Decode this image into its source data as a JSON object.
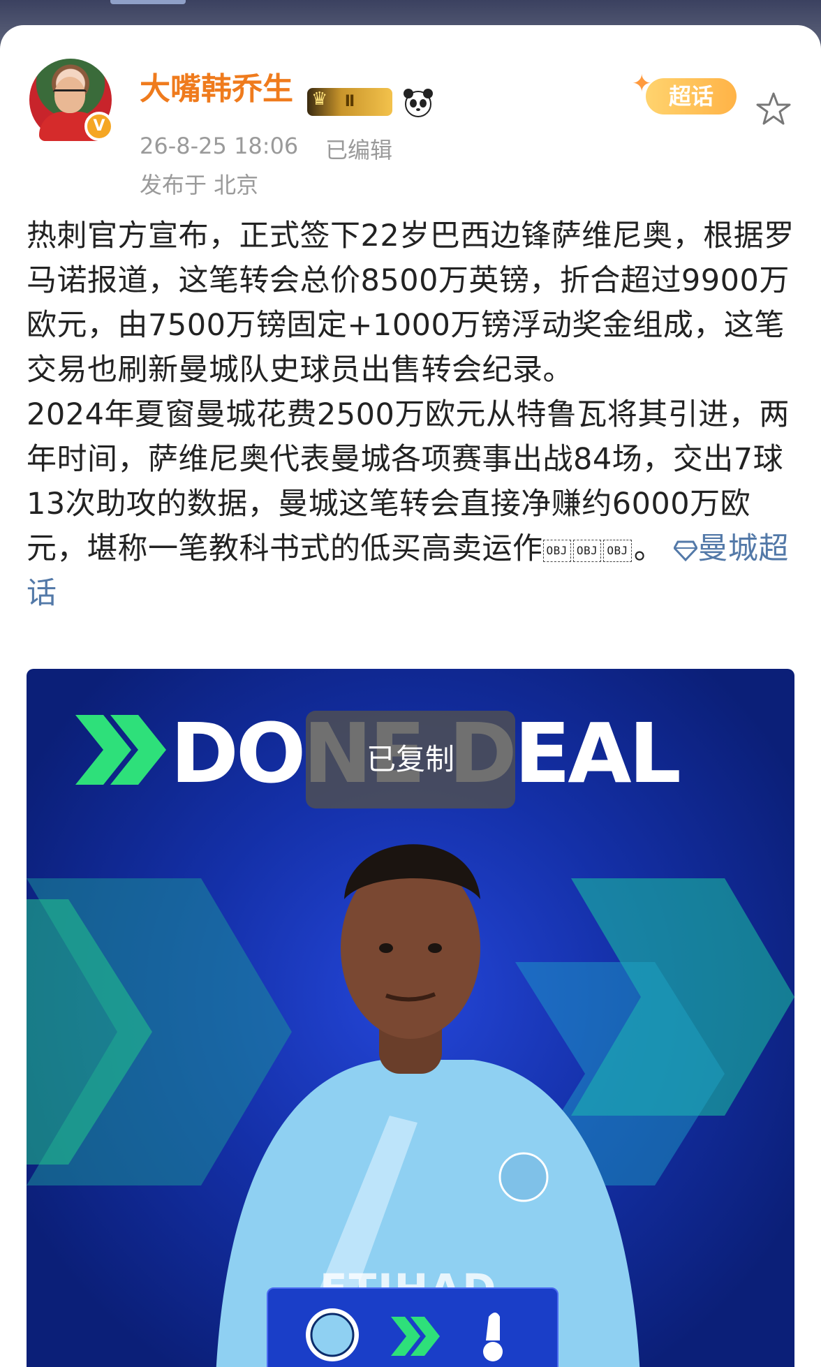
{
  "post": {
    "author": {
      "name": "大嘴韩乔生",
      "level": "Ⅱ"
    },
    "meta": {
      "time": "26-8-25 18:06",
      "edited": "已编辑",
      "location": "发布于 北京"
    },
    "super_topic_badge": "超话",
    "body_paragraph_1": "热刺官方宣布，正式签下22岁巴西边锋萨维尼奥，根据罗马诺报道，这笔转会总价8500万英镑，折合超过9900万欧元，由7500万镑固定+1000万镑浮动奖金组成，这笔交易也刷新曼城队史球员出售转会纪录。",
    "body_paragraph_2": "2024年夏窗曼城花费2500万欧元从特鲁瓦将其引进，两年时间，萨维尼奥代表曼城各项赛事出战84场，交出7球13次助攻的数据，曼城这笔转会直接净赚约6000万欧元，堪称一笔教科书式的低买高卖运作",
    "obj_placeholder": "OBJ",
    "period": "。",
    "topic_link": "曼城超话"
  },
  "image": {
    "headline": "DONE DEAL",
    "shirt_text": "ETIHAD"
  },
  "toast": {
    "text": "已复制"
  },
  "colors": {
    "username": "#ef7b1d",
    "link": "#5379a8",
    "image_bg": "#1430a8",
    "accent_green": "#2ee07a"
  }
}
